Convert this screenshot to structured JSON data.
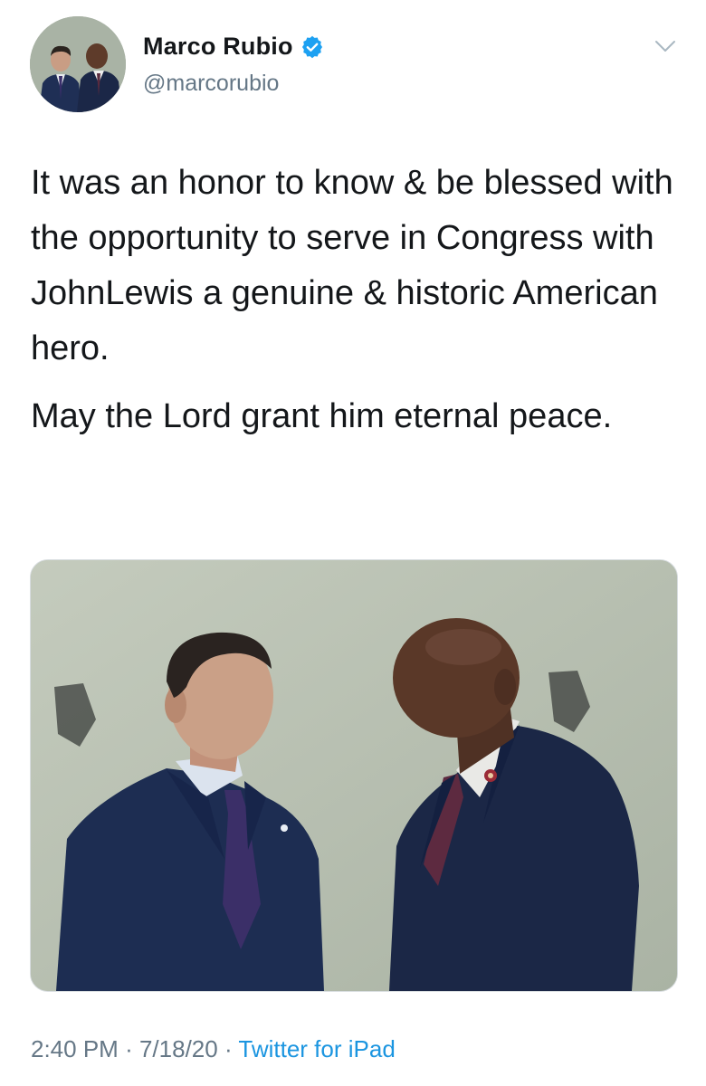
{
  "user": {
    "display_name": "Marco Rubio",
    "handle": "@marcorubio",
    "verified": true,
    "avatar_icon": "profile-photo"
  },
  "tweet": {
    "paragraphs": [
      "It was an honor to know & be blessed with the opportunity to serve in Congress with JohnLewis a genuine & historic American hero.",
      "May the Lord grant him eternal peace."
    ]
  },
  "meta": {
    "time": "2:40 PM",
    "separator": "·",
    "date": "7/18/20",
    "source": "Twitter for iPad"
  },
  "colors": {
    "verified_blue": "#1da1f2",
    "link_blue": "#1b95e0",
    "secondary_text": "#657786",
    "primary_text": "#14171a"
  }
}
